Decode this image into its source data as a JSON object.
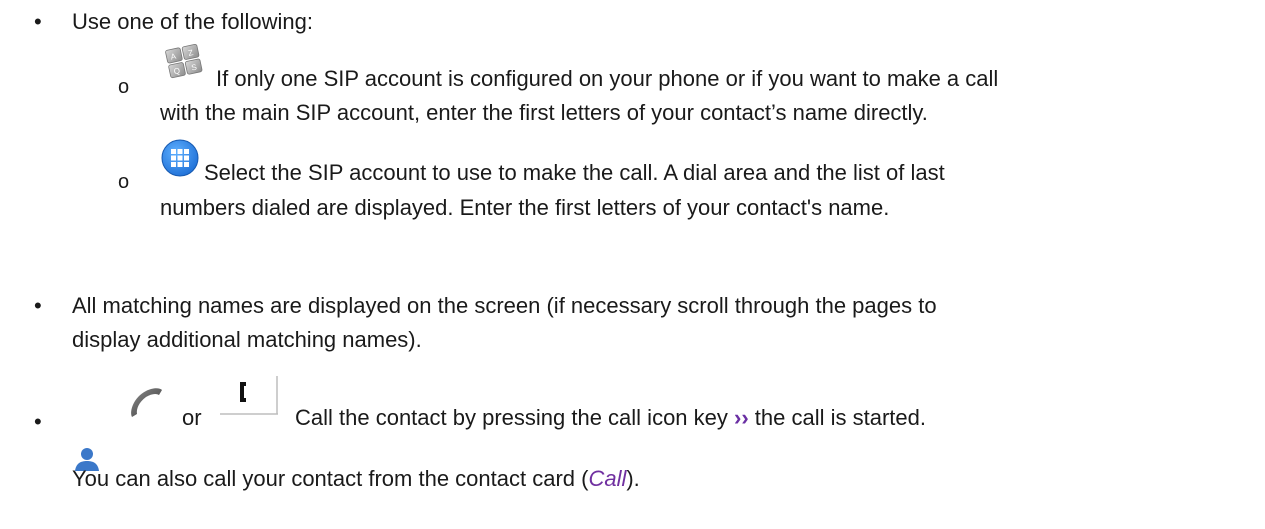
{
  "items": [
    {
      "text": "Use one of the following:"
    }
  ],
  "options": [
    {
      "icon": "keypad-icon",
      "lines": [
        "If only one SIP account is configured on your phone or if you want to make a call",
        "with the main SIP account, enter the first letters of your contact’s name directly."
      ]
    },
    {
      "icon": "dialpad-icon",
      "lines": [
        "Select the SIP account to use to make the call. A dial area and the list of last",
        "numbers dialed are displayed. Enter the first letters of your contact's name."
      ]
    }
  ],
  "matching": {
    "lines": [
      "All matching names are displayed on the screen (if necessary scroll through the pages to",
      "display additional matching names)."
    ]
  },
  "call": {
    "or_text": "or",
    "text_before": "Call the contact by pressing the call icon key",
    "arrow_glyph": "››",
    "text_after": "the call is started."
  },
  "note": {
    "text_before": "You can also call your contact from the contact card (",
    "link": "Call",
    "text_after": ")."
  },
  "bullet_glyph": "•",
  "sub_bullet_glyph": "o",
  "colors": {
    "link": "#7030a0",
    "arrow": "#6a2fa3",
    "dialpad_icon": "#1e6fd6",
    "contact_icon": "#3b78c9"
  }
}
